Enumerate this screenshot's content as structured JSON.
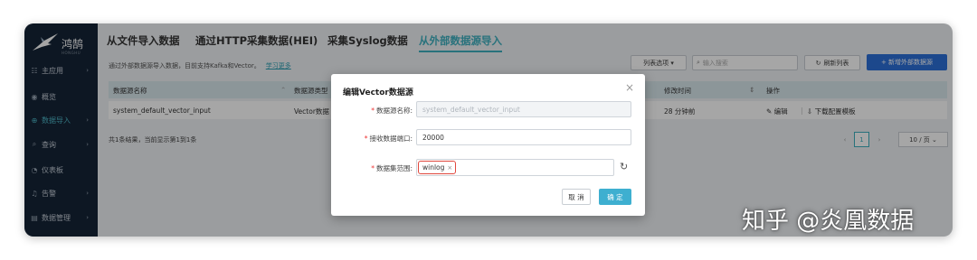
{
  "app": {
    "logo_name": "鸿鹄",
    "logo_sub": "HONGHU"
  },
  "sidebar": {
    "items": [
      {
        "label": "主应用",
        "icon": "grid-icon",
        "glyph": "☷",
        "arrow": "›"
      },
      {
        "label": "概览",
        "icon": "eye-icon",
        "glyph": "◉",
        "arrow": ""
      },
      {
        "label": "数据导入",
        "icon": "import-icon",
        "glyph": "⊕",
        "arrow": "›"
      },
      {
        "label": "查询",
        "icon": "search-icon",
        "glyph": "⌕",
        "arrow": "›"
      },
      {
        "label": "仪表板",
        "icon": "dashboard-icon",
        "glyph": "◔",
        "arrow": ""
      },
      {
        "label": "告警",
        "icon": "bell-icon",
        "glyph": "♫",
        "arrow": "›"
      },
      {
        "label": "数据管理",
        "icon": "database-icon",
        "glyph": "▤",
        "arrow": "›"
      }
    ]
  },
  "tabs": [
    "从文件导入数据",
    "通过HTTP采集数据(HEI)",
    "采集Syslog数据",
    "从外部数据源导入"
  ],
  "description": {
    "text": "通过外部数据源导入数据，目前支持Kafka和Vector。",
    "link": "学习更多"
  },
  "toolbar": {
    "list_options": "列表选项 ▾",
    "search_placeholder": "输入搜索",
    "refresh": "刷新列表",
    "add": "+ 新增外部数据源"
  },
  "table": {
    "headers": [
      "数据源名称",
      "数据源类型",
      "修改时间",
      "操作"
    ],
    "rows": [
      {
        "name": "system_default_vector_input",
        "type": "Vector数据",
        "modified": "28 分钟前",
        "edit": "编辑",
        "download": "下载配置模板"
      }
    ]
  },
  "pagination": {
    "summary": "共1条结果，当前显示第1到1条",
    "prev": "‹",
    "current": "1",
    "next": "›",
    "page_size": "10 / 页 ⌄"
  },
  "modal": {
    "title": "编辑Vector数据源",
    "close": "×",
    "fields": {
      "name_label": "数据源名称:",
      "name_value": "system_default_vector_input",
      "port_label": "接收数据端口:",
      "port_value": "20000",
      "scope_label": "数据集范围:",
      "scope_tag": "winlog"
    },
    "tag_remove": "×",
    "cancel": "取 消",
    "ok": "确 定"
  },
  "watermark": "知乎 @炎凰数据",
  "colors": {
    "accent": "#3eafbf",
    "primary": "#2b6fd8",
    "sidebar": "#142436",
    "highlight": "#e0483e"
  }
}
